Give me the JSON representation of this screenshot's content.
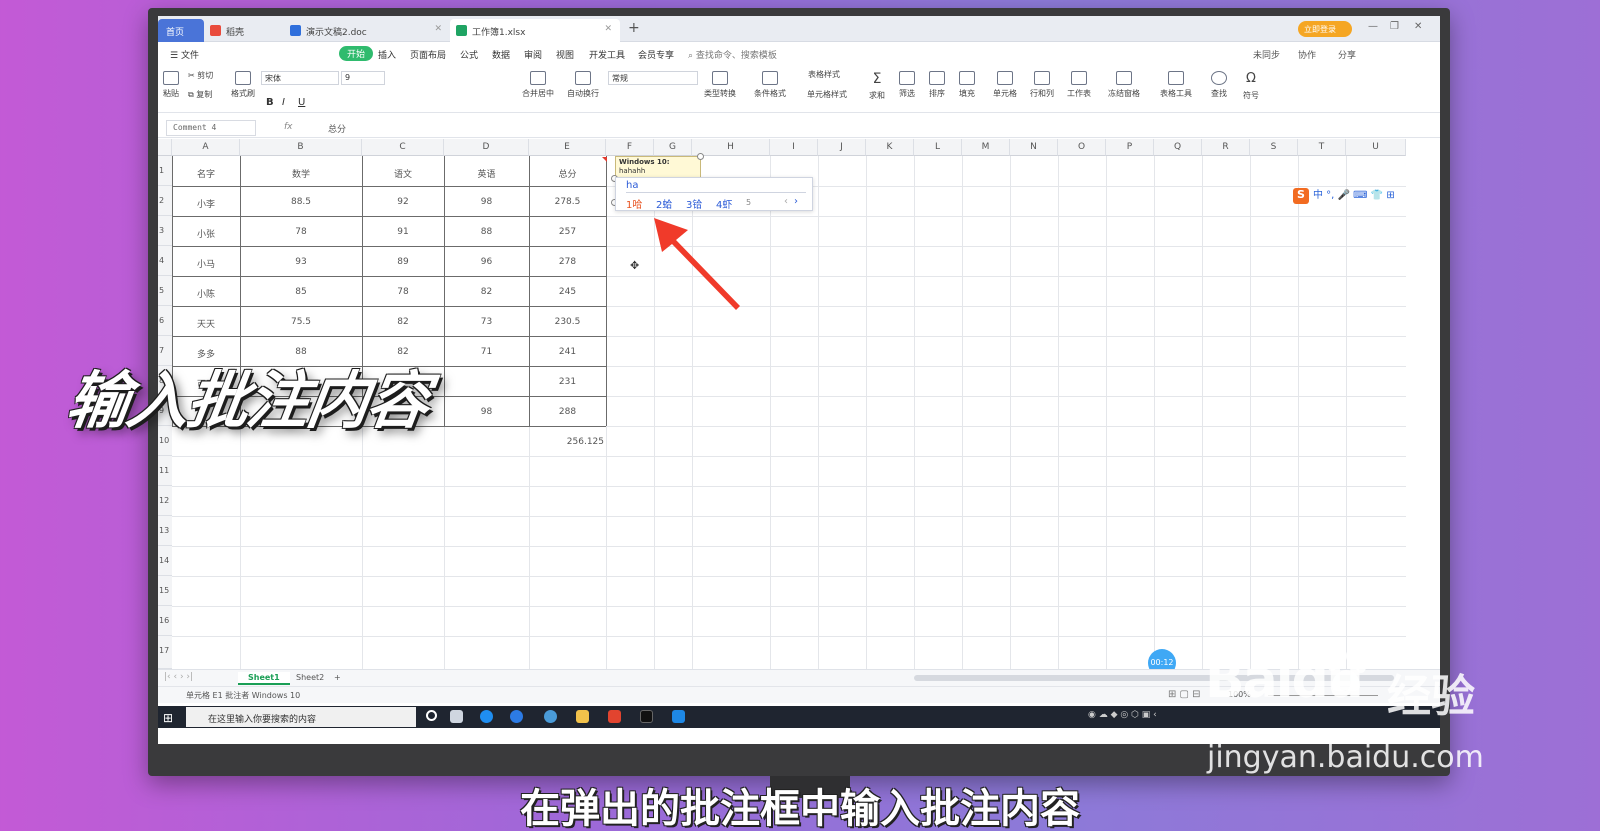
{
  "titlebar": {
    "tabs": [
      {
        "label": "首页"
      },
      {
        "label": "稻壳"
      },
      {
        "label": "演示文稿2.doc"
      },
      {
        "label": "工作簿1.xlsx"
      }
    ],
    "new_tab": "+",
    "login": "立即登录"
  },
  "menu": {
    "items": [
      "文件",
      "开始",
      "插入",
      "页面布局",
      "公式",
      "数据",
      "审阅",
      "视图",
      "开发工具",
      "会员专享"
    ],
    "search": "查找命令、搜索模板",
    "right": [
      "未同步",
      "协作",
      "分享"
    ]
  },
  "ribbon": {
    "paste": "粘贴",
    "cut": "剪切",
    "copy": "复制",
    "format_painter": "格式刷",
    "font_name": "宋体",
    "font_size": "9",
    "number_format": "常规",
    "merge": "合并居中",
    "wrap": "自动换行",
    "type_convert": "类型转换",
    "cond_format": "条件格式",
    "table_style": "表格样式",
    "cell_style": "单元格样式",
    "sum": "求和",
    "filter": "筛选",
    "sort": "排序",
    "fill": "填充",
    "cell": "单元格",
    "rowcol": "行和列",
    "sheet": "工作表",
    "freeze": "冻结窗格",
    "table_tools": "表格工具",
    "find": "查找",
    "symbol": "符号"
  },
  "formula_bar": {
    "name_box": "Comment 4",
    "fx": "fx",
    "content": "总分"
  },
  "columns": [
    "A",
    "B",
    "C",
    "D",
    "E",
    "F",
    "G",
    "H",
    "I",
    "J",
    "K",
    "L",
    "M",
    "N",
    "O",
    "P",
    "Q",
    "R",
    "S",
    "T",
    "U"
  ],
  "rows": [
    "1",
    "2",
    "3",
    "4",
    "5",
    "6",
    "7",
    "8",
    "9",
    "10",
    "11",
    "12",
    "13",
    "14",
    "15",
    "16",
    "17"
  ],
  "table": {
    "header": [
      "名字",
      "数学",
      "语文",
      "英语",
      "总分"
    ],
    "data": [
      [
        "小李",
        "88.5",
        "92",
        "98",
        "278.5"
      ],
      [
        "小张",
        "78",
        "91",
        "88",
        "257"
      ],
      [
        "小马",
        "93",
        "89",
        "96",
        "278"
      ],
      [
        "小陈",
        "85",
        "78",
        "82",
        "245"
      ],
      [
        "天天",
        "75.5",
        "82",
        "73",
        "230.5"
      ],
      [
        "多多",
        "88",
        "82",
        "71",
        "241"
      ],
      [
        "可可",
        "",
        "",
        "",
        "231"
      ],
      [
        "",
        "",
        "",
        "98",
        "288"
      ]
    ],
    "average": "256.125"
  },
  "comment": {
    "author": "Windows 10:",
    "text": "hahahh"
  },
  "ime": {
    "input": "ha",
    "candidates": [
      "1哈",
      "2蛤",
      "3铪",
      "4虾",
      "5"
    ],
    "next": "›",
    "prev": "‹"
  },
  "sogou_bar": "中 °, 🎤 ⌨ 👕 ⊞",
  "sheets": [
    "Sheet1",
    "Sheet2"
  ],
  "add_sheet": "+",
  "status": {
    "left": "单元格 E1 批注者 Windows 10",
    "zoom": "100%"
  },
  "taskbar": {
    "search_placeholder": "在这里输入你要搜索的内容"
  },
  "timer": "00:12",
  "overlay": {
    "caption": "输入批注内容",
    "subtitle": "在弹出的批注框中输入批注内容",
    "watermark_brand": "Baidu",
    "watermark_suffix": "经验",
    "watermark_url": "jingyan.baidu.com"
  },
  "colors": {
    "accent_green": "#2fbb6e",
    "wps_blue": "#4a74d8",
    "arrow_red": "#f03a2a",
    "ime_blue": "#2b5bd7"
  }
}
